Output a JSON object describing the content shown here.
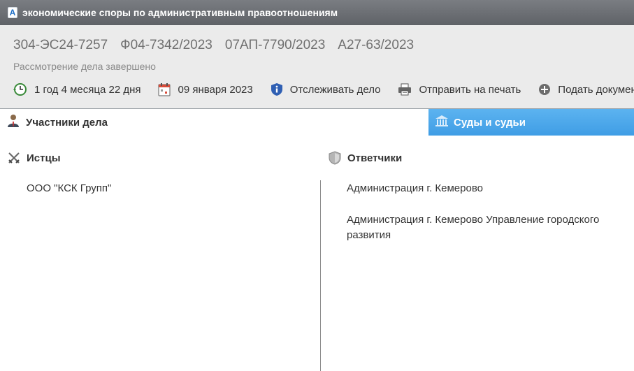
{
  "window": {
    "logo_letter": "A",
    "title": "экономические споры по административным правоотношениям"
  },
  "case": {
    "numbers": [
      "304-ЭС24-7257",
      "Ф04-7342/2023",
      "07АП-7790/2023",
      "А27-63/2023"
    ],
    "status": "Рассмотрение дела завершено"
  },
  "actions": {
    "duration": "1 год 4 месяца 22 дня",
    "date": "09 января 2023",
    "track": "Отслеживать дело",
    "print": "Отправить на печать",
    "submit": "Подать докумен"
  },
  "tabs": {
    "participants": "Участники дела",
    "courts": "Суды и судьи"
  },
  "plaintiffs": {
    "heading": "Истцы",
    "items": [
      "ООО \"КСК Групп\""
    ]
  },
  "defendants": {
    "heading": "Ответчики",
    "items": [
      "Администрация г. Кемерово",
      "Администрация г. Кемерово Управление городского развития"
    ]
  },
  "colors": {
    "titlebar": "#6b6e73",
    "header_bg": "#ebebeb",
    "tab_active_blue": "#4aa6ea",
    "case_number_text": "#707070"
  }
}
